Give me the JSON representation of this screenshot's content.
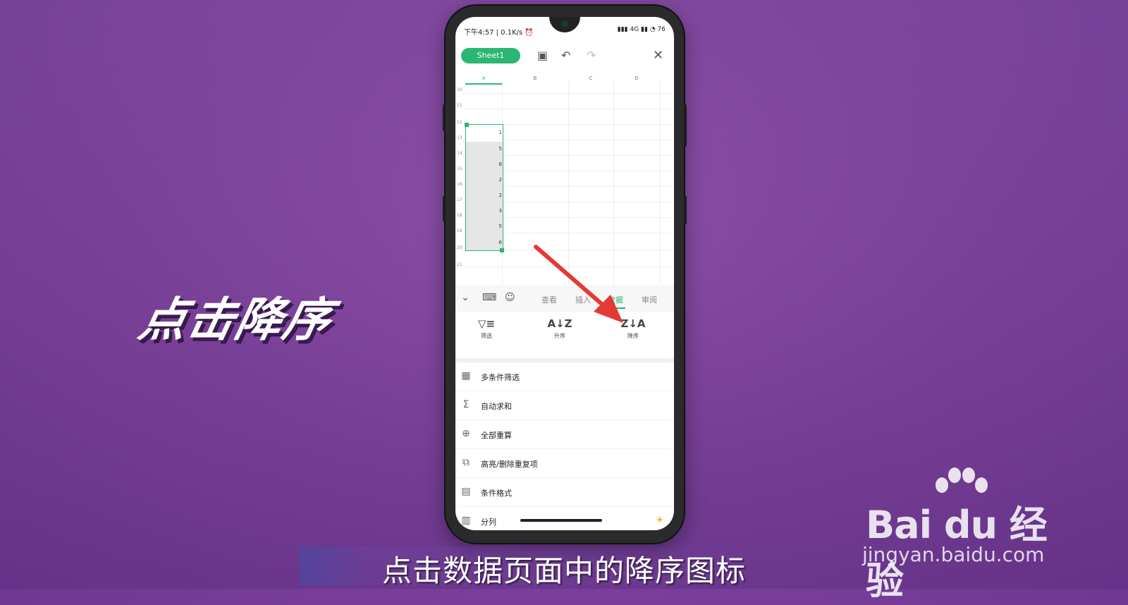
{
  "overlay": {
    "side_title": "点击降序",
    "subtitle": "点击数据页面中的降序图标",
    "watermark": {
      "brand": "Bai du 经验",
      "url": "jingyan.baidu.com"
    }
  },
  "phone": {
    "status_bar": {
      "left": "下午4:57 | 0.1K/s ⏰",
      "right": "▮▮▮ 4G ▮▮ ◔ 76"
    },
    "toolbar": {
      "sheet_tab": "Sheet1",
      "save_icon": "▣",
      "undo_icon": "↶",
      "redo_icon": "↷",
      "close_icon": "✕"
    },
    "grid": {
      "columns": [
        "A",
        "B",
        "C",
        "D"
      ],
      "rows": [
        "10",
        "11",
        "12",
        "13",
        "14",
        "15",
        "16",
        "17",
        "18",
        "19",
        "20",
        "21"
      ],
      "selected_values": [
        "1",
        "5",
        "8",
        "2",
        "2",
        "3",
        "5",
        "6"
      ]
    },
    "tabbar": {
      "collapse_icon": "⌄",
      "tabs": [
        "查看",
        "插入",
        "数据",
        "审阅"
      ],
      "active_tab": "数据"
    },
    "actions": [
      {
        "label": "筛选",
        "icon": "▽≡"
      },
      {
        "label": "升序",
        "icon": "A↓Z"
      },
      {
        "label": "降序",
        "icon": "Z↓A"
      }
    ],
    "menu": [
      {
        "label": "多条件筛选",
        "icon": "▦"
      },
      {
        "label": "自动求和",
        "icon": "Σ"
      },
      {
        "label": "全部重算",
        "icon": "⊕"
      },
      {
        "label": "高亮/删除重复项",
        "icon": "⧉"
      },
      {
        "label": "条件格式",
        "icon": "▤"
      },
      {
        "label": "分列",
        "icon": "▥"
      }
    ],
    "colors": {
      "accent": "#2bb673",
      "arrow": "#e53935"
    }
  }
}
